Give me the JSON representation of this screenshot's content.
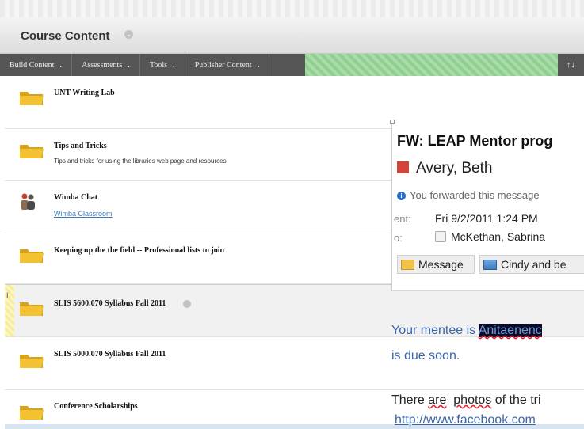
{
  "header": {
    "title": "Course Content"
  },
  "toolbar": {
    "items": [
      {
        "label": "Build Content"
      },
      {
        "label": "Assessments"
      },
      {
        "label": "Tools"
      },
      {
        "label": "Publisher Content"
      }
    ],
    "sort_icon": "sort-arrows-icon"
  },
  "content_items": [
    {
      "title": "UNT Writing Lab",
      "icon": "folder-icon"
    },
    {
      "title": "Tips and Tricks",
      "description": "Tips and tricks for using the libraries web page and resources",
      "icon": "folder-icon"
    },
    {
      "title": "Wimba Chat",
      "link": "Wimba Classroom",
      "icon": "wimba-chat-icon"
    },
    {
      "title": "Keeping up the the field -- Professional lists to join",
      "icon": "folder-icon"
    },
    {
      "title": "SLIS 5600.070 Syllabus Fall 2011",
      "icon": "folder-icon",
      "highlighted": true
    },
    {
      "title": "SLIS 5000.070 Syllabus Fall 2011",
      "icon": "folder-icon"
    },
    {
      "title": "Conference Scholarships",
      "icon": "folder-icon"
    }
  ],
  "email": {
    "subject": "FW: LEAP Mentor prog",
    "sender": "Avery, Beth",
    "forward_notice": "You forwarded this message",
    "sent_label": "ent:",
    "sent_value": "Fri 9/2/2011 1:24 PM",
    "to_label": "o:",
    "to_value": "McKethan, Sabrina",
    "tabs": [
      {
        "label": "Message"
      },
      {
        "label": "Cindy and be"
      }
    ],
    "body": {
      "line1_prefix": "Your mentee is ",
      "line1_name": "Anitaenenc",
      "line2": "is due soon.",
      "line3_a": "There ",
      "line3_are": "are",
      "line3_b": "  ",
      "line3_photos": "photos",
      "line3_c": " of the tri",
      "link": "http://www.facebook.com"
    }
  },
  "colors": {
    "toolbar_bg": "#555555",
    "toolbar_stripe": "#8fcf8f",
    "folder": "#f2c232",
    "link": "#3a7ab8",
    "email_body_blue": "#3a66a8"
  }
}
